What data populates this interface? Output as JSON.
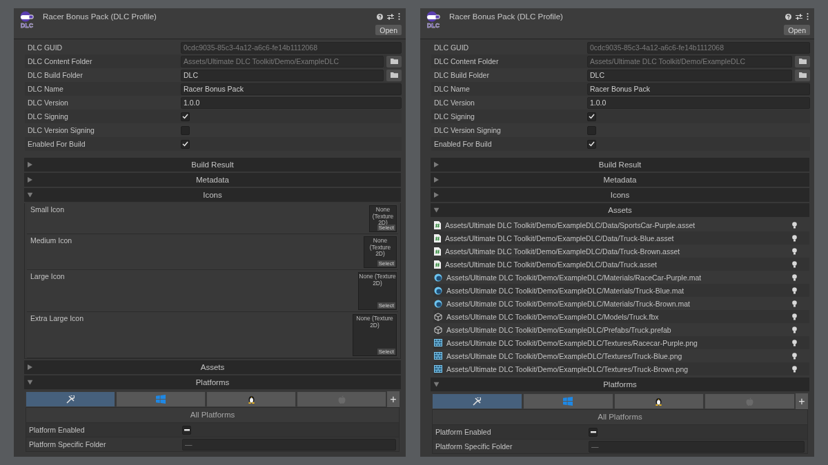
{
  "panels": [
    {
      "title": "Racer Bonus Pack (DLC Profile)",
      "logo_text": "DLC",
      "open_button": "Open",
      "fields": [
        {
          "kind": "text",
          "label": "DLC GUID",
          "value": "0cdc9035-85c3-4a12-a6c6-fe14b1112068",
          "disabled": true
        },
        {
          "kind": "folder",
          "label": "DLC Content Folder",
          "value": "Assets/Ultimate DLC Toolkit/Demo/ExampleDLC",
          "disabled": true
        },
        {
          "kind": "folder",
          "label": "DLC Build Folder",
          "value": "DLC",
          "disabled": false
        },
        {
          "kind": "text",
          "label": "DLC Name",
          "value": "Racer Bonus Pack",
          "disabled": false
        },
        {
          "kind": "text",
          "label": "DLC Version",
          "value": "1.0.0",
          "disabled": false
        },
        {
          "kind": "checkbox",
          "label": "DLC Signing",
          "checked": true
        },
        {
          "kind": "checkbox",
          "label": "DLC Version Signing",
          "checked": false
        },
        {
          "kind": "checkbox",
          "label": "Enabled For Build",
          "checked": true
        }
      ],
      "sections": [
        {
          "title": "Build Result",
          "expanded": false
        },
        {
          "title": "Metadata",
          "expanded": false
        },
        {
          "kind": "icons",
          "title": "Icons",
          "expanded": true,
          "slots": [
            {
              "label": "Small Icon",
              "value": "None (Texture 2D)",
              "button": "Select"
            },
            {
              "label": "Medium Icon",
              "value": "None (Texture 2D)",
              "button": "Select"
            },
            {
              "label": "Large Icon",
              "value": "None (Texture 2D)",
              "button": "Select"
            },
            {
              "label": "Extra Large Icon",
              "value": "None (Texture 2D)",
              "button": "Select"
            }
          ]
        },
        {
          "title": "Assets",
          "expanded": false
        },
        {
          "kind": "platforms",
          "title": "Platforms",
          "expanded": true,
          "tabs": [
            {
              "kind": "tools",
              "selected": true
            },
            {
              "kind": "windows",
              "selected": false
            },
            {
              "kind": "linux",
              "selected": false
            },
            {
              "kind": "apple",
              "selected": false
            }
          ],
          "add_button": "+",
          "subtitle": "All Platforms",
          "rows": [
            {
              "kind": "checkbox",
              "label": "Platform Enabled",
              "mixed": true
            },
            {
              "kind": "field",
              "label": "Platform Specific Folder",
              "value": "—"
            }
          ]
        }
      ]
    },
    {
      "title": "Racer Bonus Pack (DLC Profile)",
      "logo_text": "DLC",
      "open_button": "Open",
      "fields": [
        {
          "kind": "text",
          "label": "DLC GUID",
          "value": "0cdc9035-85c3-4a12-a6c6-fe14b1112068",
          "disabled": true
        },
        {
          "kind": "folder",
          "label": "DLC Content Folder",
          "value": "Assets/Ultimate DLC Toolkit/Demo/ExampleDLC",
          "disabled": true
        },
        {
          "kind": "folder",
          "label": "DLC Build Folder",
          "value": "DLC",
          "disabled": false
        },
        {
          "kind": "text",
          "label": "DLC Name",
          "value": "Racer Bonus Pack",
          "disabled": false
        },
        {
          "kind": "text",
          "label": "DLC Version",
          "value": "1.0.0",
          "disabled": false
        },
        {
          "kind": "checkbox",
          "label": "DLC Signing",
          "checked": true
        },
        {
          "kind": "checkbox",
          "label": "DLC Version Signing",
          "checked": false
        },
        {
          "kind": "checkbox",
          "label": "Enabled For Build",
          "checked": true
        }
      ],
      "sections": [
        {
          "title": "Build Result",
          "expanded": false
        },
        {
          "title": "Metadata",
          "expanded": false
        },
        {
          "title": "Icons",
          "expanded": false
        },
        {
          "kind": "assets",
          "title": "Assets",
          "expanded": true,
          "items": [
            {
              "kind": "script",
              "path": "Assets/Ultimate DLC Toolkit/Demo/ExampleDLC/Data/SportsCar-Purple.asset"
            },
            {
              "kind": "script",
              "path": "Assets/Ultimate DLC Toolkit/Demo/ExampleDLC/Data/Truck-Blue.asset"
            },
            {
              "kind": "script",
              "path": "Assets/Ultimate DLC Toolkit/Demo/ExampleDLC/Data/Truck-Brown.asset"
            },
            {
              "kind": "script",
              "path": "Assets/Ultimate DLC Toolkit/Demo/ExampleDLC/Data/Truck.asset"
            },
            {
              "kind": "material",
              "path": "Assets/Ultimate DLC Toolkit/Demo/ExampleDLC/Materials/RaceCar-Purple.mat"
            },
            {
              "kind": "material",
              "path": "Assets/Ultimate DLC Toolkit/Demo/ExampleDLC/Materials/Truck-Blue.mat"
            },
            {
              "kind": "material",
              "path": "Assets/Ultimate DLC Toolkit/Demo/ExampleDLC/Materials/Truck-Brown.mat"
            },
            {
              "kind": "model",
              "path": "Assets/Ultimate DLC Toolkit/Demo/ExampleDLC/Models/Truck.fbx"
            },
            {
              "kind": "model",
              "path": "Assets/Ultimate DLC Toolkit/Demo/ExampleDLC/Prefabs/Truck.prefab"
            },
            {
              "kind": "texture",
              "path": "Assets/Ultimate DLC Toolkit/Demo/ExampleDLC/Textures/Racecar-Purple.png"
            },
            {
              "kind": "texture",
              "path": "Assets/Ultimate DLC Toolkit/Demo/ExampleDLC/Textures/Truck-Blue.png"
            },
            {
              "kind": "texture",
              "path": "Assets/Ultimate DLC Toolkit/Demo/ExampleDLC/Textures/Truck-Brown.png"
            }
          ]
        },
        {
          "kind": "platforms",
          "title": "Platforms",
          "expanded": true,
          "tabs": [
            {
              "kind": "tools",
              "selected": true
            },
            {
              "kind": "windows",
              "selected": false
            },
            {
              "kind": "linux",
              "selected": false
            },
            {
              "kind": "apple",
              "selected": false
            }
          ],
          "add_button": "+",
          "subtitle": "All Platforms",
          "rows": [
            {
              "kind": "checkbox",
              "label": "Platform Enabled",
              "mixed": true
            },
            {
              "kind": "field",
              "label": "Platform Specific Folder",
              "value": "—"
            }
          ]
        }
      ]
    }
  ]
}
